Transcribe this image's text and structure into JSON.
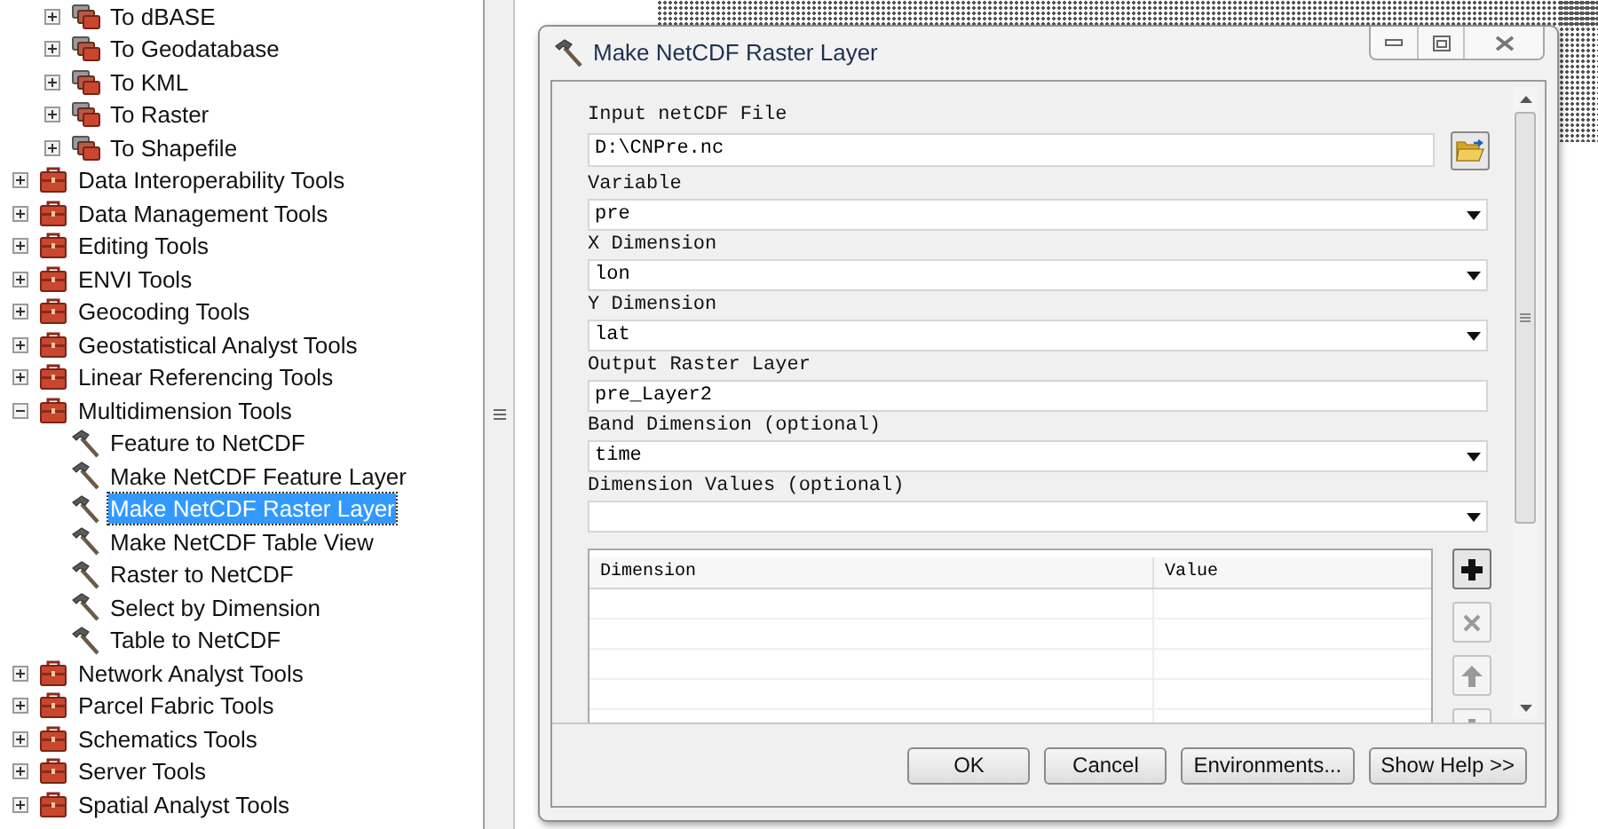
{
  "tree": {
    "scrolled_children": [
      {
        "label": "To dBASE",
        "kind": "toolset",
        "expanded": false
      },
      {
        "label": "To Geodatabase",
        "kind": "toolset",
        "expanded": false
      },
      {
        "label": "To KML",
        "kind": "toolset",
        "expanded": false
      },
      {
        "label": "To Raster",
        "kind": "toolset",
        "expanded": false
      },
      {
        "label": "To Shapefile",
        "kind": "toolset",
        "expanded": false
      }
    ],
    "toolboxes": [
      {
        "label": "Data Interoperability Tools",
        "kind": "toolbox",
        "expanded": false
      },
      {
        "label": "Data Management Tools",
        "kind": "toolbox",
        "expanded": false
      },
      {
        "label": "Editing Tools",
        "kind": "toolbox",
        "expanded": false
      },
      {
        "label": "ENVI Tools",
        "kind": "toolbox",
        "expanded": false
      },
      {
        "label": "Geocoding Tools",
        "kind": "toolbox",
        "expanded": false
      },
      {
        "label": "Geostatistical Analyst Tools",
        "kind": "toolbox",
        "expanded": false
      },
      {
        "label": "Linear Referencing Tools",
        "kind": "toolbox",
        "expanded": false
      },
      {
        "label": "Multidimension Tools",
        "kind": "toolbox",
        "expanded": true,
        "children": [
          {
            "label": "Feature to NetCDF",
            "kind": "tool",
            "selected": false
          },
          {
            "label": "Make NetCDF Feature Layer",
            "kind": "tool",
            "selected": false
          },
          {
            "label": "Make NetCDF Raster Layer",
            "kind": "tool",
            "selected": true
          },
          {
            "label": "Make NetCDF Table View",
            "kind": "tool",
            "selected": false
          },
          {
            "label": "Raster to NetCDF",
            "kind": "tool",
            "selected": false
          },
          {
            "label": "Select by Dimension",
            "kind": "tool",
            "selected": false
          },
          {
            "label": "Table to NetCDF",
            "kind": "tool",
            "selected": false
          }
        ]
      },
      {
        "label": "Network Analyst Tools",
        "kind": "toolbox",
        "expanded": false
      },
      {
        "label": "Parcel Fabric Tools",
        "kind": "toolbox",
        "expanded": false
      },
      {
        "label": "Schematics Tools",
        "kind": "toolbox",
        "expanded": false
      },
      {
        "label": "Server Tools",
        "kind": "toolbox",
        "expanded": false
      },
      {
        "label": "Spatial Analyst Tools",
        "kind": "toolbox",
        "expanded": false
      }
    ]
  },
  "dialog": {
    "title": "Make NetCDF Raster Layer",
    "fields": [
      {
        "label": "Input netCDF File",
        "kind": "file",
        "value": "D:\\CNPre.nc"
      },
      {
        "label": "Variable",
        "kind": "dropdown",
        "value": "pre"
      },
      {
        "label": "X Dimension",
        "kind": "dropdown",
        "value": "lon"
      },
      {
        "label": "Y Dimension",
        "kind": "dropdown",
        "value": "lat"
      },
      {
        "label": "Output Raster Layer",
        "kind": "text",
        "value": "pre_Layer2"
      },
      {
        "label": "Band Dimension (optional)",
        "kind": "dropdown",
        "value": "time"
      },
      {
        "label": "Dimension Values (optional)",
        "kind": "dropdown"
      }
    ],
    "table": {
      "columns": [
        "Dimension",
        "Value"
      ],
      "side_buttons": [
        {
          "kind": "add",
          "disabled": false
        },
        {
          "kind": "remove",
          "disabled": true
        },
        {
          "kind": "up",
          "disabled": true
        },
        {
          "kind": "down",
          "disabled": true
        }
      ]
    },
    "buttons": [
      "OK",
      "Cancel",
      "Environments...",
      "Show Help >>"
    ]
  }
}
